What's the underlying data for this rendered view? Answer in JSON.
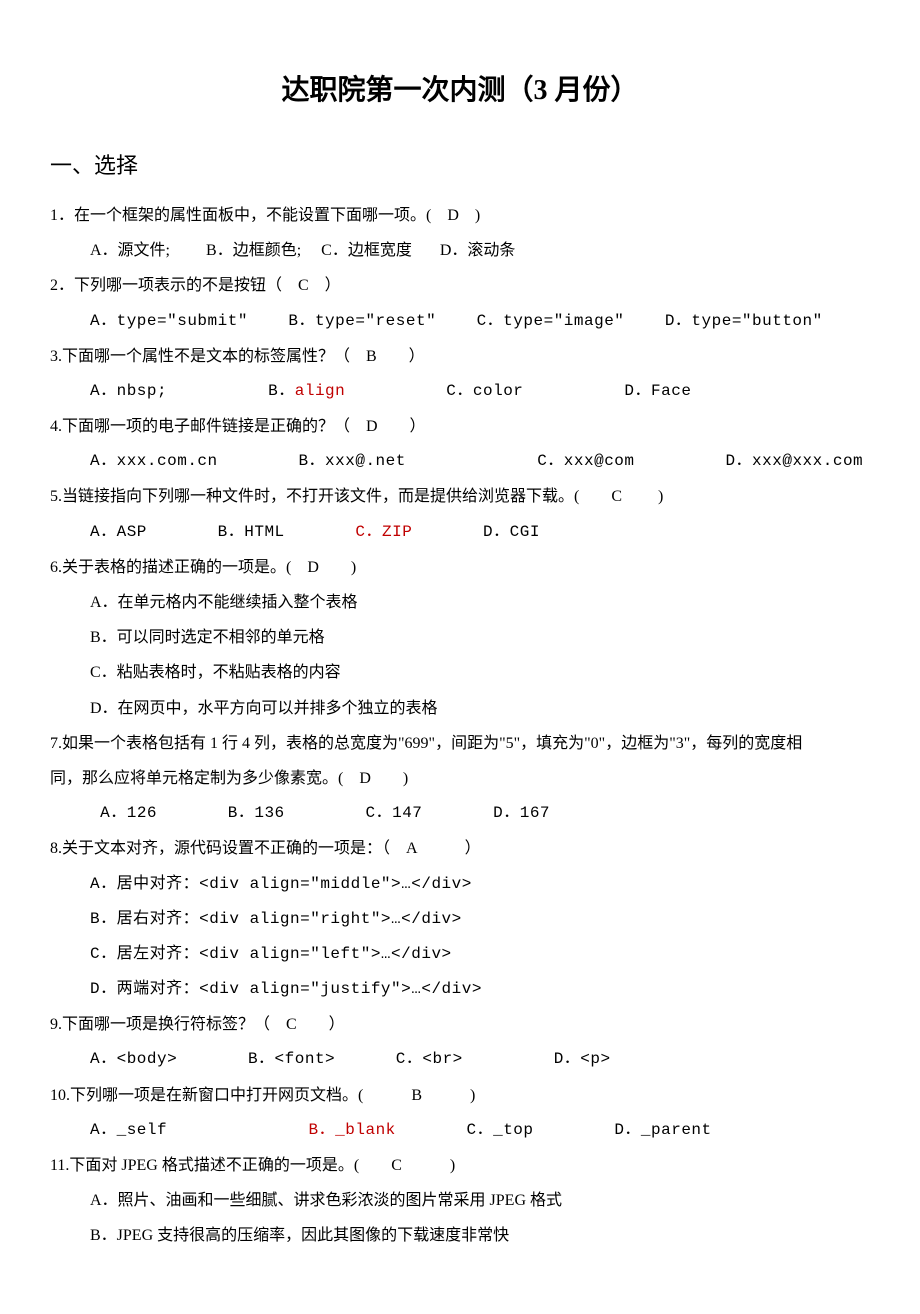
{
  "title": "达职院第一次内测（3 月份）",
  "section": "一、选择",
  "q1": {
    "stem": "1．在一个框架的属性面板中，不能设置下面哪一项。(　D　)",
    "a": "A．源文件;",
    "b": "B．边框颜色;",
    "c": "C．边框宽度",
    "d": "D．滚动条"
  },
  "q2": {
    "stem": "2．下列哪一项表示的不是按钮（　C　）",
    "a": "A．type=\"submit\"",
    "b": "B．type=\"reset\"",
    "c": "C．type=\"image\"",
    "d": "D．type=\"button\""
  },
  "q3": {
    "stem": "3.下面哪一个属性不是文本的标签属性？（　B　　）",
    "a": "A．nbsp;",
    "b_pre": "B．",
    "b_red": "align",
    "c": "C．color",
    "d": "D．Face"
  },
  "q4": {
    "stem": "4.下面哪一项的电子邮件链接是正确的？（　D　　）",
    "a": "A．xxx.com.cn",
    "b": "B．xxx@.net",
    "c": "C．xxx@com",
    "d": "D．xxx@xxx.com"
  },
  "q5": {
    "stem": "5.当链接指向下列哪一种文件时，不打开该文件，而是提供给浏览器下载。(　　C 　　)",
    "a": "A．ASP",
    "b": "B．HTML",
    "c_pre": "C．",
    "c_red": "ZIP",
    "d": "D．CGI"
  },
  "q6": {
    "stem": "6.关于表格的描述正确的一项是。(　D　　)",
    "a": "A．在单元格内不能继续插入整个表格",
    "b": "B．可以同时选定不相邻的单元格",
    "c": "C．粘贴表格时，不粘贴表格的内容",
    "d": "D．在网页中，水平方向可以并排多个独立的表格"
  },
  "q7": {
    "stem1": "7.如果一个表格包括有 1 行 4 列，表格的总宽度为\"699\"，间距为\"5\"，填充为\"0\"，边框为\"3\"，每列的宽度相",
    "stem2": "同，那么应将单元格定制为多少像素宽。(　D　　)",
    "a": "A．126",
    "b": "B．136",
    "c": "C．147",
    "d": "D．167"
  },
  "q8": {
    "stem": "8.关于文本对齐，源代码设置不正确的一项是：（　A　　　）",
    "a": "A．居中对齐：<div align=\"middle\">…</div>",
    "b": "B．居右对齐：<div align=\"right\">…</div>",
    "c": "C．居左对齐：<div align=\"left\">…</div>",
    "d": "D．两端对齐：<div align=\"justify\">…</div>"
  },
  "q9": {
    "stem": "9.下面哪一项是换行符标签？（　C　　）",
    "a": "A．<body>",
    "b": "B．<font>",
    "c": "C．<br>",
    "d": "D．<p>"
  },
  "q10": {
    "stem": "10.下列哪一项是在新窗口中打开网页文档。(　　　B　　　)",
    "a": "A．_self",
    "b_pre": "B．",
    "b_red": "_blank",
    "c": "C．_top",
    "d": "D．_parent"
  },
  "q11": {
    "stem": "11.下面对 JPEG 格式描述不正确的一项是。(　　C　　　)",
    "a": "A．照片、油画和一些细腻、讲求色彩浓淡的图片常采用 JPEG 格式",
    "b": "B．JPEG 支持很高的压缩率，因此其图像的下载速度非常快"
  }
}
